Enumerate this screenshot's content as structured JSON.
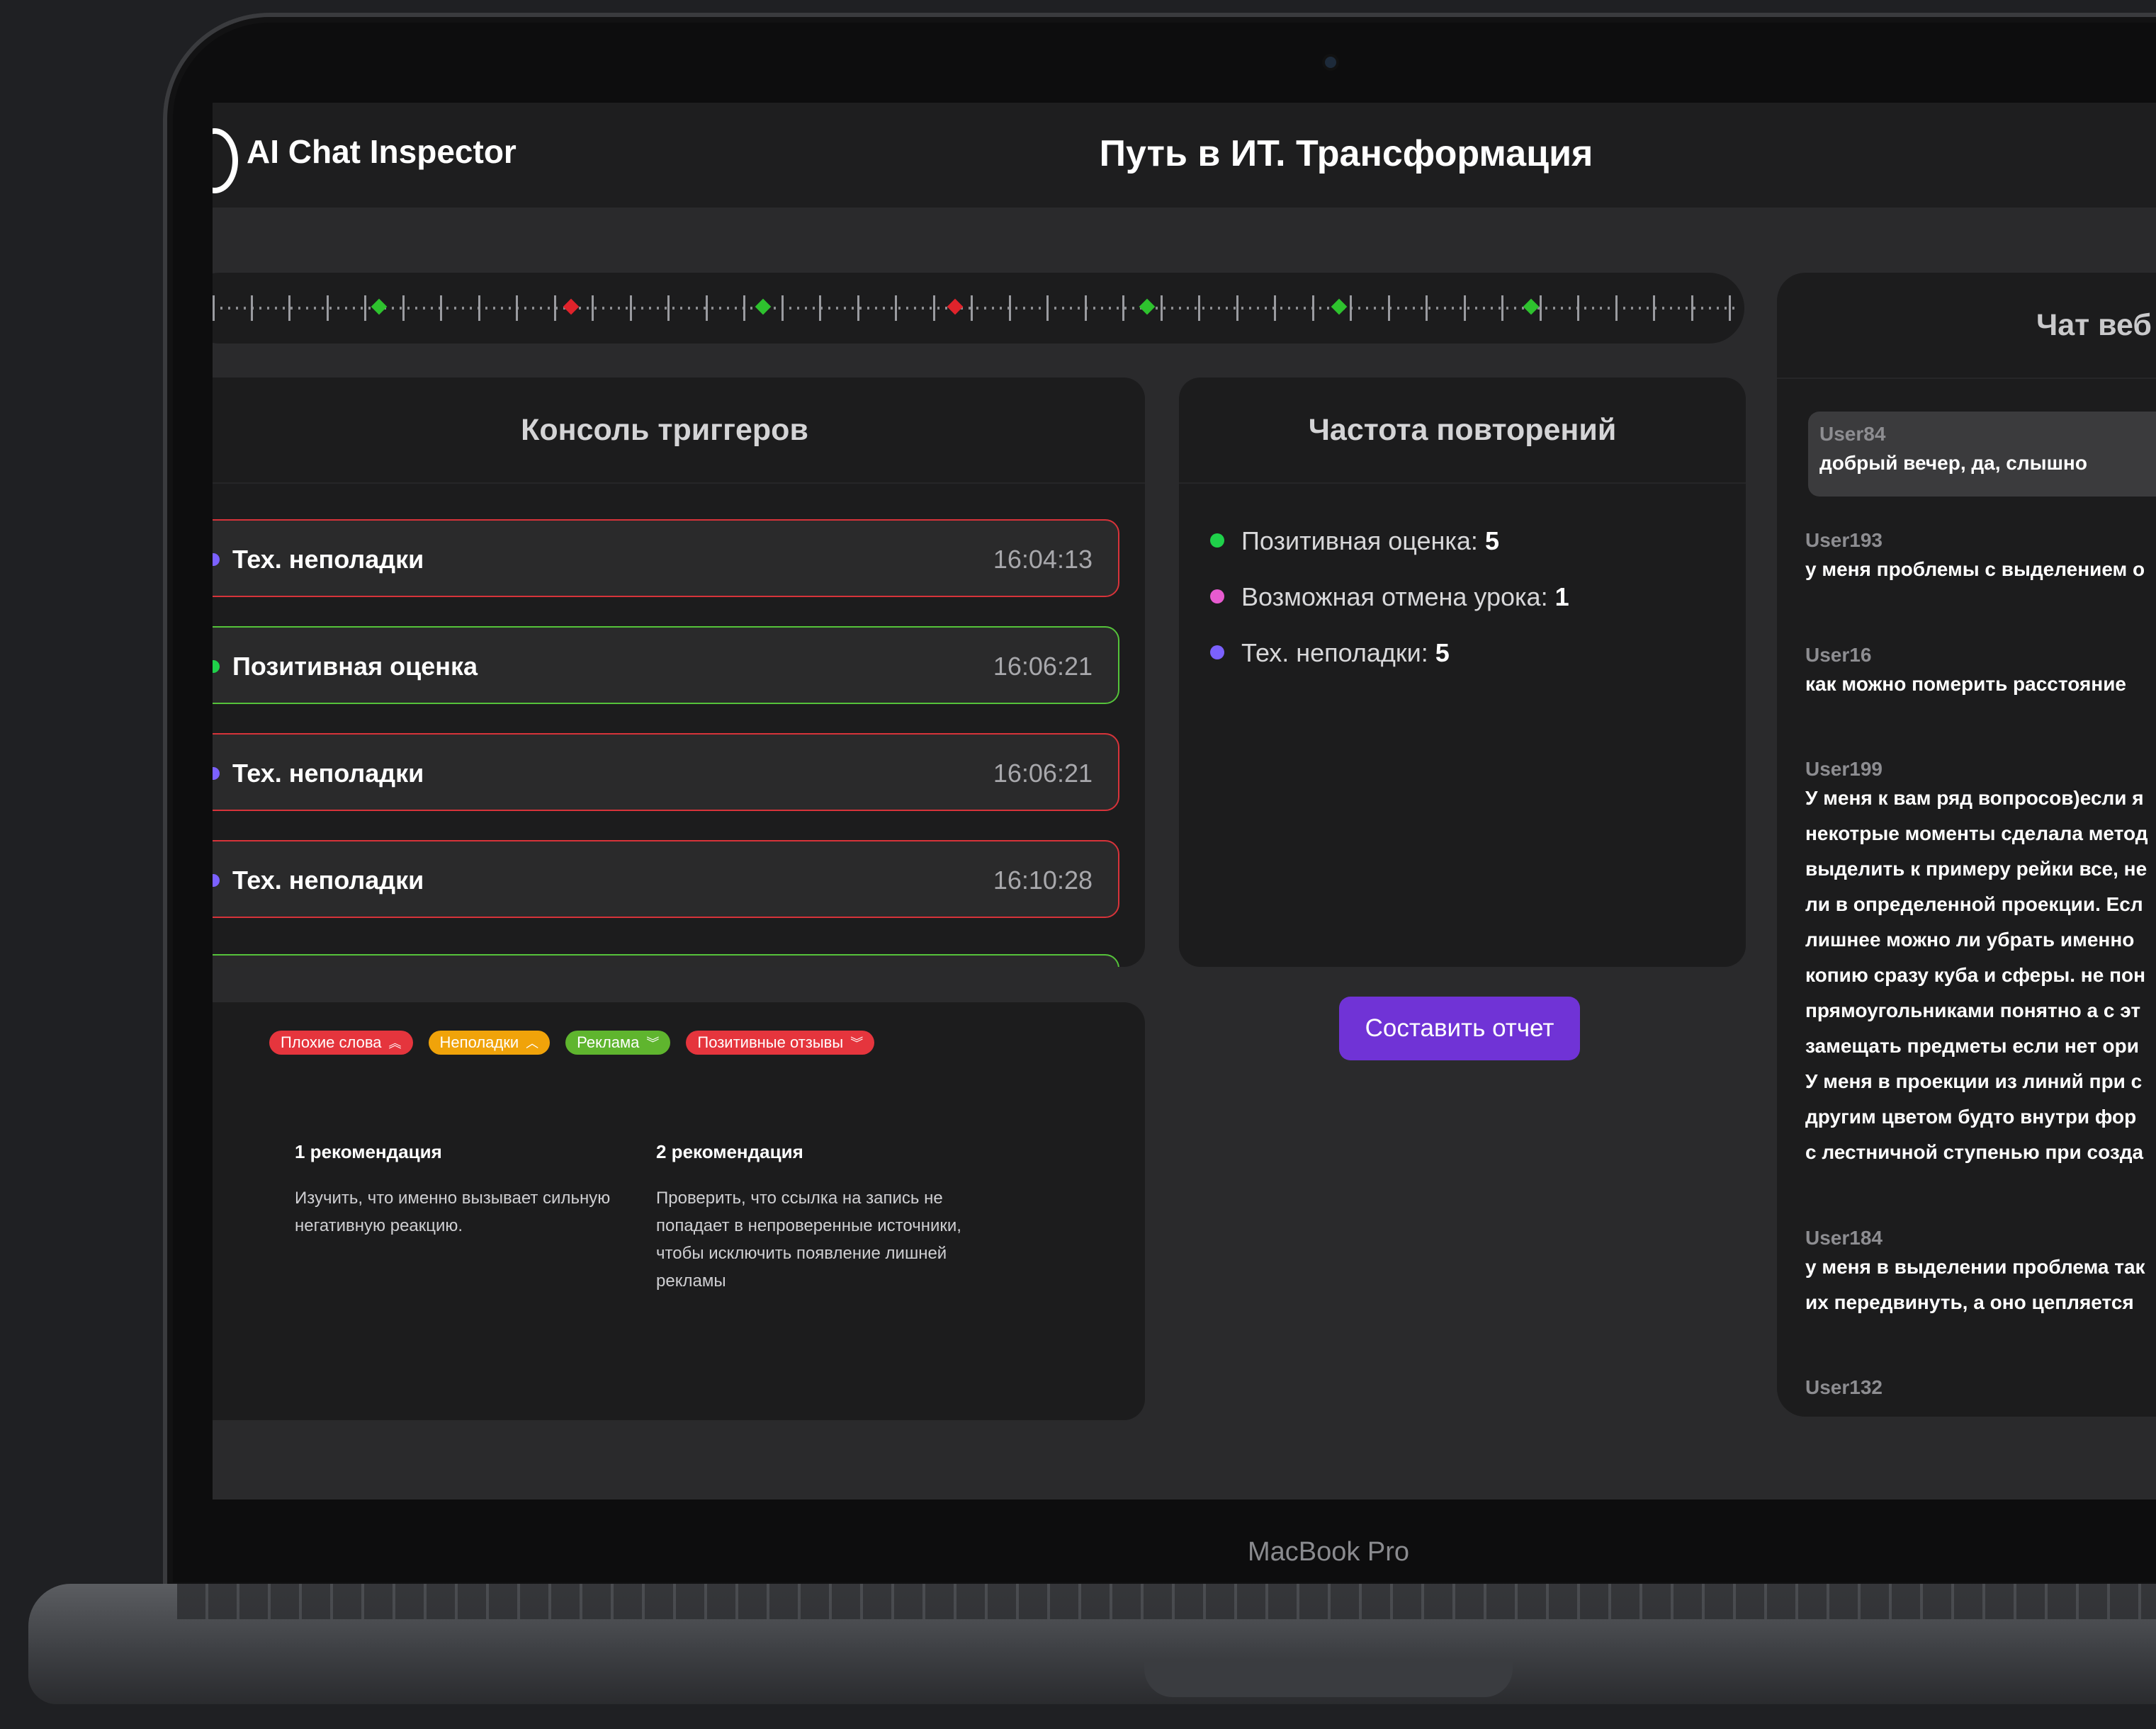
{
  "device": {
    "label": "MacBook Pro"
  },
  "header": {
    "app_name": "AI Chat Inspector",
    "title": "Путь в ИТ. Трансформация"
  },
  "colors": {
    "positive": "#2ec22e",
    "negative": "#e0232b",
    "accent": "#7033d6",
    "purple_dot": "#7b61ff",
    "pink_dot": "#e85bd0",
    "green_dot": "#1fd14a"
  },
  "timeline": {
    "markers": [
      "positive",
      "negative",
      "positive",
      "negative",
      "positive",
      "positive",
      "positive"
    ]
  },
  "triggers": {
    "title": "Консоль триггеров",
    "items": [
      {
        "name": "Тех. неполадки",
        "time": "16:04:13",
        "border": "#d7333a",
        "dot": "#7b61ff"
      },
      {
        "name": "Позитивная оценка",
        "time": "16:06:21",
        "border": "#55c33a",
        "dot": "#1fd14a"
      },
      {
        "name": "Тех. неполадки",
        "time": "16:06:21",
        "border": "#d7333a",
        "dot": "#7b61ff"
      },
      {
        "name": "Тех. неполадки",
        "time": "16:10:28",
        "border": "#d7333a",
        "dot": "#7b61ff"
      }
    ]
  },
  "frequency": {
    "title": "Частота повторений",
    "items": [
      {
        "label": "Позитивная оценка:",
        "count": "5",
        "color": "#1fd14a"
      },
      {
        "label": "Возможная отмена урока:",
        "count": "1",
        "color": "#e85bd0"
      },
      {
        "label": "Тех. неполадки:",
        "count": "5",
        "color": "#7b61ff"
      }
    ]
  },
  "report_button": "Составить отчет",
  "filters": {
    "tags": [
      {
        "label": "Плохие слова",
        "color": "#e5353d",
        "chevron": "double-up"
      },
      {
        "label": "Неполадки",
        "color": "#f0a30a",
        "chevron": "up"
      },
      {
        "label": "Реклама",
        "color": "#5fb52e",
        "chevron": "double-down"
      },
      {
        "label": "Позитивные отзывы",
        "color": "#e5353d",
        "chevron": "double-down"
      }
    ]
  },
  "recommendations": [
    {
      "title": "1 рекомендация",
      "text": "Изучить, что именно вызывает сильную негативную реакцию."
    },
    {
      "title": "2 рекомендация",
      "text": "Проверить, что ссылка на запись не попадает в непроверенные источники, чтобы исключить появление лишней рекламы"
    }
  ],
  "chat": {
    "title": "Чат веб",
    "messages": [
      {
        "user": "User84",
        "lines": [
          "добрый вечер, да, слышно"
        ]
      },
      {
        "user": "User193",
        "lines": [
          "у меня проблемы с выделением о"
        ]
      },
      {
        "user": "User16",
        "lines": [
          "как можно померить расстояние"
        ]
      },
      {
        "user": "User199",
        "lines": [
          "У меня к вам ряд вопросов)если я",
          "некотрые моменты сделала метод",
          "выделить к примеру рейки все, не",
          "ли в определенной проекции. Есл",
          "лишнее можно ли убрать именно",
          "копию сразу куба и сферы. не пон",
          "прямоугольниками понятно а с эт",
          "замещать предметы если нет ори",
          "У меня в проекции из линий при с",
          "другим цветом будто внутри фор",
          "с лестничной ступенью при созда"
        ]
      },
      {
        "user": "User184",
        "lines": [
          "у меня в выделении проблема так",
          "их передвинуть, а оно цепляется"
        ]
      },
      {
        "user": "User132",
        "lines": []
      }
    ]
  }
}
